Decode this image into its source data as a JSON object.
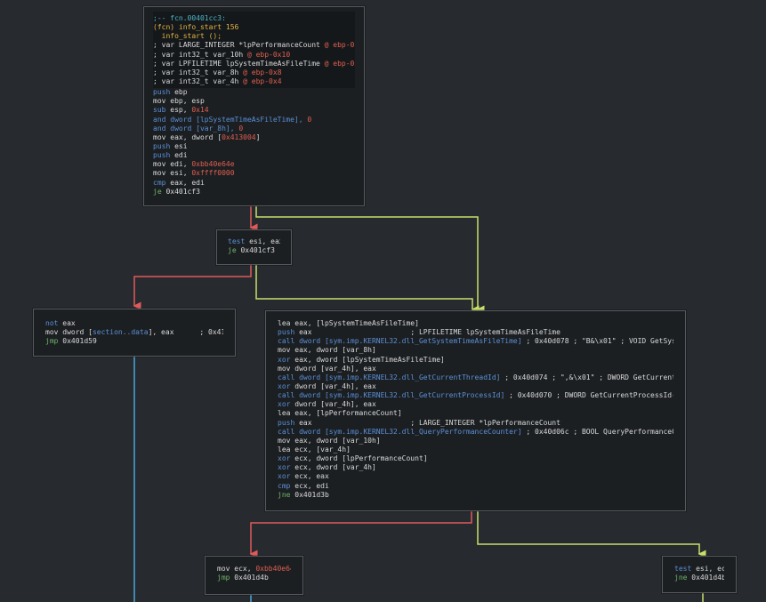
{
  "colors": {
    "background": "#272a2e",
    "node_background": "#1c1f22",
    "node_border": "#55595e",
    "edge_true": "#c8e06a",
    "edge_false": "#e05a5a",
    "edge_uncond": "#4aa8d8"
  },
  "nodes": [
    {
      "name": "node-fcn-00401cc3",
      "header": [
        [
          {
            "t": ";-- fcn.00401cc3:",
            "c": "comment"
          }
        ],
        [
          {
            "t": "(fcn) info_start 156",
            "c": "fcn"
          }
        ],
        [
          {
            "t": "  info_start ();",
            "c": "fcn"
          }
        ],
        [
          {
            "t": "; var LARGE_INTEGER *lpPerformanceCount ",
            "c": "def"
          },
          {
            "t": "@ ebp-0x14",
            "c": "num"
          }
        ],
        [
          {
            "t": "; var int32_t var_10h ",
            "c": "def"
          },
          {
            "t": "@ ebp-0x10",
            "c": "num"
          }
        ],
        [
          {
            "t": "; var LPFILETIME lpSystemTimeAsFileTime ",
            "c": "def"
          },
          {
            "t": "@ ebp-0xc",
            "c": "num"
          }
        ],
        [
          {
            "t": "; var int32_t var_8h ",
            "c": "def"
          },
          {
            "t": "@ ebp-0x8",
            "c": "num"
          }
        ],
        [
          {
            "t": "; var int32_t var_4h ",
            "c": "def"
          },
          {
            "t": "@ ebp-0x4",
            "c": "num"
          }
        ]
      ],
      "lines": [
        [
          {
            "t": "push ",
            "c": "blue"
          },
          {
            "t": "ebp",
            "c": "def"
          }
        ],
        [
          {
            "t": "mov ",
            "c": "def"
          },
          {
            "t": "ebp, esp",
            "c": "def"
          }
        ],
        [
          {
            "t": "sub ",
            "c": "blue"
          },
          {
            "t": "esp, ",
            "c": "def"
          },
          {
            "t": "0x14",
            "c": "num"
          }
        ],
        [
          {
            "t": "and ",
            "c": "blue"
          },
          {
            "t": "dword [lpSystemTimeAsFileTime], ",
            "c": "blue"
          },
          {
            "t": "0",
            "c": "num"
          }
        ],
        [
          {
            "t": "and ",
            "c": "blue"
          },
          {
            "t": "dword [var_8h], ",
            "c": "blue"
          },
          {
            "t": "0",
            "c": "num"
          }
        ],
        [
          {
            "t": "mov ",
            "c": "def"
          },
          {
            "t": "eax, dword [",
            "c": "def"
          },
          {
            "t": "0x413004",
            "c": "num"
          },
          {
            "t": "]",
            "c": "def"
          }
        ],
        [
          {
            "t": "push ",
            "c": "blue"
          },
          {
            "t": "esi",
            "c": "def"
          }
        ],
        [
          {
            "t": "push ",
            "c": "blue"
          },
          {
            "t": "edi",
            "c": "def"
          }
        ],
        [
          {
            "t": "mov ",
            "c": "def"
          },
          {
            "t": "edi, ",
            "c": "def"
          },
          {
            "t": "0xbb40e64e",
            "c": "num"
          }
        ],
        [
          {
            "t": "mov ",
            "c": "def"
          },
          {
            "t": "esi, ",
            "c": "def"
          },
          {
            "t": "0xffff0000",
            "c": "num"
          }
        ],
        [
          {
            "t": "cmp ",
            "c": "blue"
          },
          {
            "t": "eax, edi",
            "c": "def"
          }
        ],
        [
          {
            "t": "je ",
            "c": "green"
          },
          {
            "t": "0x401cf3",
            "c": "def"
          }
        ]
      ]
    },
    {
      "name": "node-test-esi-eax",
      "header": [],
      "lines": [
        [
          {
            "t": "test ",
            "c": "blue"
          },
          {
            "t": "esi, eax",
            "c": "def"
          }
        ],
        [
          {
            "t": "je ",
            "c": "green"
          },
          {
            "t": "0x401cf3",
            "c": "def"
          }
        ]
      ]
    },
    {
      "name": "node-not-eax",
      "header": [],
      "lines": [
        [
          {
            "t": "not ",
            "c": "blue"
          },
          {
            "t": "eax",
            "c": "def"
          }
        ],
        [
          {
            "t": "mov ",
            "c": "def"
          },
          {
            "t": "dword [",
            "c": "def"
          },
          {
            "t": "section..data",
            "c": "blue"
          },
          {
            "t": "], eax      ; 0x413000",
            "c": "def"
          }
        ],
        [
          {
            "t": "jmp ",
            "c": "green"
          },
          {
            "t": "0x401d59",
            "c": "def"
          }
        ]
      ]
    },
    {
      "name": "node-lea-eax",
      "header": [],
      "lines": [
        [
          {
            "t": "lea ",
            "c": "def"
          },
          {
            "t": "eax, [lpSystemTimeAsFileTime]",
            "c": "def"
          }
        ],
        [
          {
            "t": "push ",
            "c": "blue"
          },
          {
            "t": "eax                       ; LPFILETIME lpSystemTimeAsFileTime",
            "c": "def"
          }
        ],
        [
          {
            "t": "call dword [sym.imp.KERNEL32.dll_GetSystemTimeAsFileTime]",
            "c": "blue"
          },
          {
            "t": " ; 0x40d078 ; \"B&\\x01\" ; VOID GetSystemT...",
            "c": "def"
          }
        ],
        [
          {
            "t": "mov ",
            "c": "def"
          },
          {
            "t": "eax, dword [var_8h]",
            "c": "def"
          }
        ],
        [
          {
            "t": "xor ",
            "c": "blue"
          },
          {
            "t": "eax, dword [lpSystemTimeAsFileTime]",
            "c": "def"
          }
        ],
        [
          {
            "t": "mov ",
            "c": "def"
          },
          {
            "t": "dword [var_4h], eax",
            "c": "def"
          }
        ],
        [
          {
            "t": "call dword [sym.imp.KERNEL32.dll_GetCurrentThreadId]",
            "c": "blue"
          },
          {
            "t": " ; 0x40d074 ; \",&\\x01\" ; DWORD GetCurrentThre...",
            "c": "def"
          }
        ],
        [
          {
            "t": "xor ",
            "c": "blue"
          },
          {
            "t": "dword [var_4h], eax",
            "c": "def"
          }
        ],
        [
          {
            "t": "call dword [sym.imp.KERNEL32.dll_GetCurrentProcessId]",
            "c": "blue"
          },
          {
            "t": " ; 0x40d070 ; DWORD GetCurrentProcessId(void)",
            "c": "def"
          }
        ],
        [
          {
            "t": "xor ",
            "c": "blue"
          },
          {
            "t": "dword [var_4h], eax",
            "c": "def"
          }
        ],
        [
          {
            "t": "lea ",
            "c": "def"
          },
          {
            "t": "eax, [lpPerformanceCount]",
            "c": "def"
          }
        ],
        [
          {
            "t": "push ",
            "c": "blue"
          },
          {
            "t": "eax                       ; LARGE_INTEGER *lpPerformanceCount",
            "c": "def"
          }
        ],
        [
          {
            "t": "call dword [sym.imp.KERNEL32.dll_QueryPerformanceCounter]",
            "c": "blue"
          },
          {
            "t": " ; 0x40d06c ; BOOL QueryPerformanceCount...",
            "c": "def"
          }
        ],
        [
          {
            "t": "mov ",
            "c": "def"
          },
          {
            "t": "eax, dword [var_10h]",
            "c": "def"
          }
        ],
        [
          {
            "t": "lea ",
            "c": "def"
          },
          {
            "t": "ecx, [var_4h]",
            "c": "def"
          }
        ],
        [
          {
            "t": "xor ",
            "c": "blue"
          },
          {
            "t": "ecx, dword [lpPerformanceCount]",
            "c": "def"
          }
        ],
        [
          {
            "t": "xor ",
            "c": "blue"
          },
          {
            "t": "ecx, dword [var_4h]",
            "c": "def"
          }
        ],
        [
          {
            "t": "xor ",
            "c": "blue"
          },
          {
            "t": "ecx, eax",
            "c": "def"
          }
        ],
        [
          {
            "t": "cmp ",
            "c": "blue"
          },
          {
            "t": "ecx, edi",
            "c": "def"
          }
        ],
        [
          {
            "t": "jne ",
            "c": "green"
          },
          {
            "t": "0x401d3b",
            "c": "def"
          }
        ]
      ]
    },
    {
      "name": "node-mov-ecx",
      "header": [],
      "lines": [
        [
          {
            "t": "mov ",
            "c": "def"
          },
          {
            "t": "ecx, ",
            "c": "def"
          },
          {
            "t": "0xbb40e64f",
            "c": "num"
          }
        ],
        [
          {
            "t": "jmp ",
            "c": "green"
          },
          {
            "t": "0x401d4b",
            "c": "def"
          }
        ]
      ]
    },
    {
      "name": "node-test-esi-ecx",
      "header": [],
      "lines": [
        [
          {
            "t": "test ",
            "c": "blue"
          },
          {
            "t": "esi, ecx",
            "c": "def"
          }
        ],
        [
          {
            "t": "jne ",
            "c": "green"
          },
          {
            "t": "0x401d4b",
            "c": "def"
          }
        ]
      ]
    }
  ]
}
